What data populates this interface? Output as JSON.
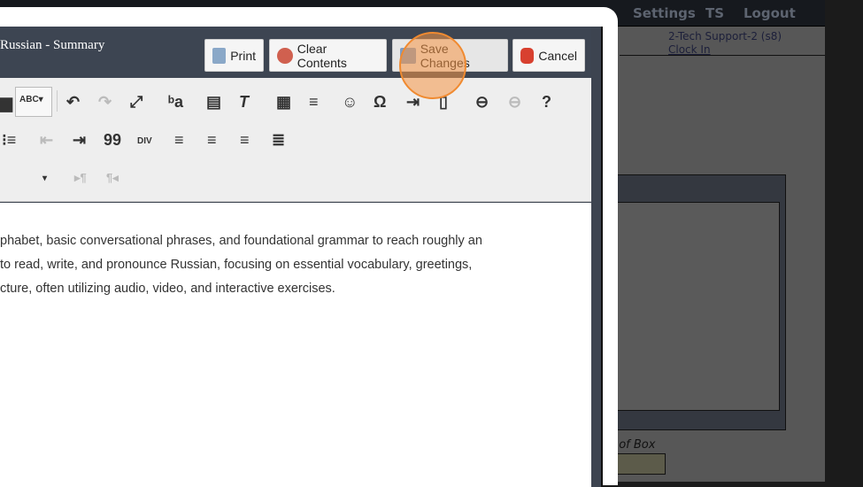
{
  "nav": {
    "items": [
      "Settings",
      "TS",
      "Logout"
    ]
  },
  "user": {
    "name": "2-Tech Support-2 (s8)",
    "clock_in": "Clock In"
  },
  "box_label": "t of Box",
  "dialog": {
    "title": "Russian - Summary",
    "buttons": {
      "print": "Print",
      "clear": "Clear Contents",
      "save": "Save Changes",
      "cancel": "Cancel"
    }
  },
  "toolbar": {
    "spellcheck": "ABC",
    "help": "?",
    "omega": "Ω",
    "quote": "99",
    "div": "DIV"
  },
  "content": {
    "lines": [
      "phabet, basic conversational phrases, and foundational grammar to reach roughly an",
      "to read, write, and pronounce Russian, focusing on essential vocabulary, greetings,",
      "cture, often utilizing audio, video, and interactive exercises."
    ]
  }
}
